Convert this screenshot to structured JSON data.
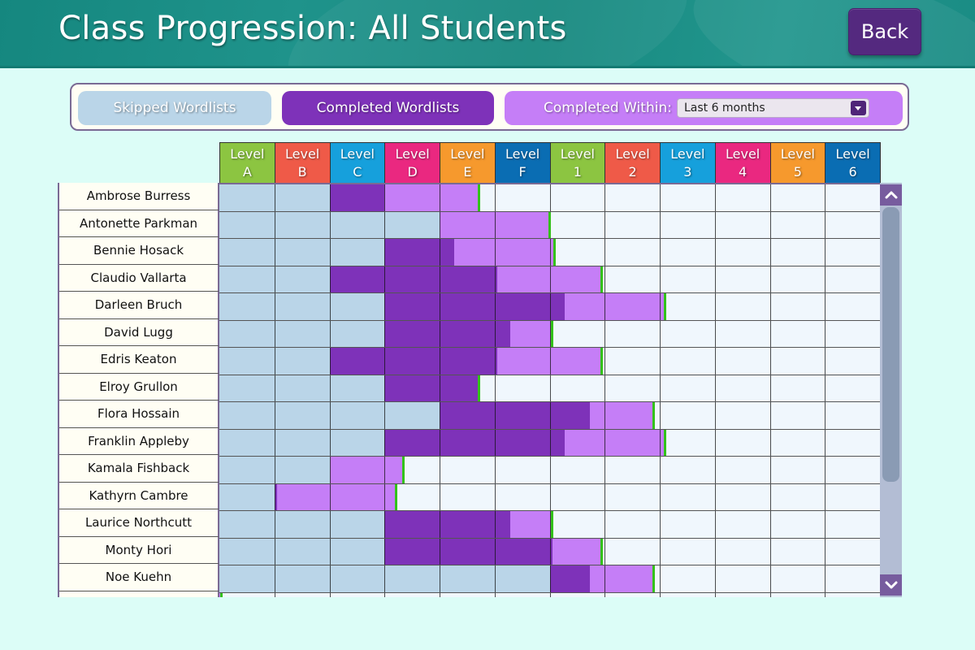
{
  "header": {
    "title": "Class Progression: All Students",
    "back_label": "Back"
  },
  "filters": {
    "skipped_label": "Skipped Wordlists",
    "completed_label": "Completed Wordlists",
    "within_label": "Completed Within:",
    "within_selected": "Last 6 months"
  },
  "colors": {
    "skipped": "#bad5e8",
    "completed_before": "#7e32b9",
    "completed_within": "#c57ef7",
    "current_marker": "#33c21a",
    "empty": "#f0f7fd"
  },
  "levels": [
    {
      "word": "Level",
      "id": "A",
      "color": "#8cc541"
    },
    {
      "word": "Level",
      "id": "B",
      "color": "#ef5a48"
    },
    {
      "word": "Level",
      "id": "C",
      "color": "#16a0dc"
    },
    {
      "word": "Level",
      "id": "D",
      "color": "#ea2880"
    },
    {
      "word": "Level",
      "id": "E",
      "color": "#f6992d"
    },
    {
      "word": "Level",
      "id": "F",
      "color": "#0a6db3"
    },
    {
      "word": "Level",
      "id": "1",
      "color": "#8cc541"
    },
    {
      "word": "Level",
      "id": "2",
      "color": "#ef5a48"
    },
    {
      "word": "Level",
      "id": "3",
      "color": "#16a0dc"
    },
    {
      "word": "Level",
      "id": "4",
      "color": "#ea2880"
    },
    {
      "word": "Level",
      "id": "5",
      "color": "#f6992d"
    },
    {
      "word": "Level",
      "id": "6",
      "color": "#0a6db3"
    }
  ],
  "students": [
    {
      "name": "Ambrose Burress",
      "skipped_to": 2,
      "completed_before_to": 3,
      "completed_within_to": 4.73
    },
    {
      "name": "Antonette Parkman",
      "skipped_to": 4,
      "completed_before_to": 4,
      "completed_within_to": 6.0
    },
    {
      "name": "Bennie Hosack",
      "skipped_to": 3,
      "completed_before_to": 4.26,
      "completed_within_to": 6.1
    },
    {
      "name": "Claudio Vallarta",
      "skipped_to": 2,
      "completed_before_to": 5.05,
      "completed_within_to": 6.95
    },
    {
      "name": "Darleen Bruch",
      "skipped_to": 3,
      "completed_before_to": 6.28,
      "completed_within_to": 8.1
    },
    {
      "name": "David Lugg",
      "skipped_to": 3,
      "completed_before_to": 5.28,
      "completed_within_to": 6.05
    },
    {
      "name": "Edris Keaton",
      "skipped_to": 2,
      "completed_before_to": 5.05,
      "completed_within_to": 6.95
    },
    {
      "name": "Elroy Grullon",
      "skipped_to": 3,
      "completed_before_to": 4.73,
      "completed_within_to": 4.73
    },
    {
      "name": "Flora Hossain",
      "skipped_to": 4,
      "completed_before_to": 6.73,
      "completed_within_to": 7.9
    },
    {
      "name": "Franklin Appleby",
      "skipped_to": 3,
      "completed_before_to": 6.28,
      "completed_within_to": 8.1
    },
    {
      "name": "Kamala Fishback",
      "skipped_to": 2,
      "completed_before_to": 2,
      "completed_within_to": 3.35
    },
    {
      "name": "Kathyrn Cambre",
      "skipped_to": 1,
      "completed_before_to": 1.05,
      "completed_within_to": 3.22
    },
    {
      "name": "Laurice Northcutt",
      "skipped_to": 3,
      "completed_before_to": 5.28,
      "completed_within_to": 6.05
    },
    {
      "name": "Monty Hori",
      "skipped_to": 3,
      "completed_before_to": 6.05,
      "completed_within_to": 6.95
    },
    {
      "name": "Noe Kuehn",
      "skipped_to": 6,
      "completed_before_to": 6.73,
      "completed_within_to": 7.9
    },
    {
      "name": "",
      "skipped_to": 0,
      "completed_before_to": 0,
      "completed_within_to": 0.05
    }
  ],
  "scrollbar": {
    "position_fraction": 0,
    "visible_fraction": 0.72
  }
}
